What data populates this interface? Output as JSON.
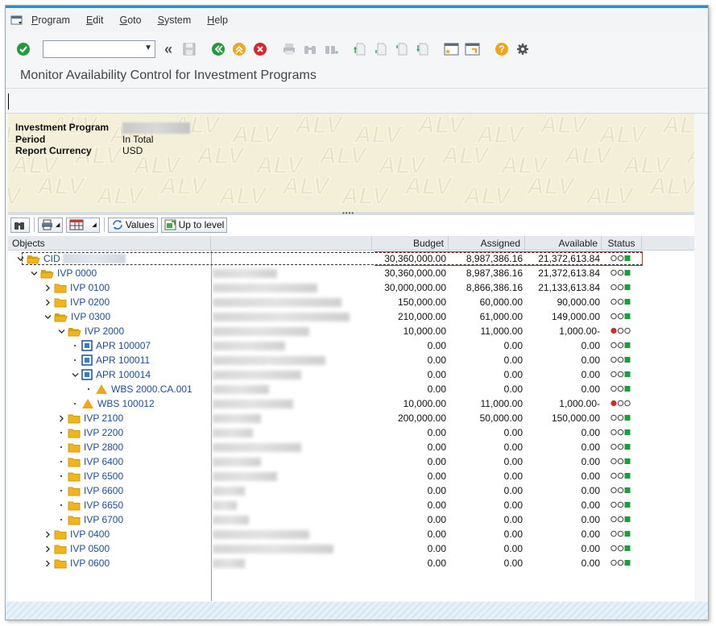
{
  "menu": {
    "items": [
      {
        "label": "Program",
        "underline": "P",
        "rest": "rogram"
      },
      {
        "label": "Edit",
        "underline": "E",
        "rest": "dit"
      },
      {
        "label": "Goto",
        "underline": "G",
        "rest": "oto"
      },
      {
        "label": "System",
        "underline": "S",
        "rest": "ystem"
      },
      {
        "label": "Help",
        "underline": "H",
        "rest": "elp"
      }
    ]
  },
  "title": "Monitor Availability Control for Investment Programs",
  "header": {
    "rows": [
      {
        "key": "Investment Program",
        "value": ""
      },
      {
        "key": "Period",
        "value": "In Total"
      },
      {
        "key": "Report Currency",
        "value": "USD"
      }
    ],
    "watermark": "ALV"
  },
  "grid_toolbar": {
    "values_label": "Values",
    "up_label": "Up to level"
  },
  "columns": {
    "objects": "Objects",
    "budget": "Budget",
    "assigned": "Assigned",
    "available": "Available",
    "status": "Status"
  },
  "rows": [
    {
      "label": "CID",
      "level": 0,
      "icon": "folder-open",
      "expander": "open",
      "budget": "30,360,000.00",
      "assigned": "8,987,386.16",
      "available": "21,372,613.84",
      "status": "green",
      "desc_w": 0
    },
    {
      "label": "IVP 0000",
      "level": 1,
      "icon": "folder-open",
      "expander": "open",
      "budget": "30,360,000.00",
      "assigned": "8,987,386.16",
      "available": "21,372,613.84",
      "status": "green",
      "desc_w": 80
    },
    {
      "label": "IVP 0100",
      "level": 2,
      "icon": "folder",
      "expander": "closed",
      "budget": "30,000,000.00",
      "assigned": "8,866,386.16",
      "available": "21,133,613.84",
      "status": "green",
      "desc_w": 130
    },
    {
      "label": "IVP 0200",
      "level": 2,
      "icon": "folder",
      "expander": "closed",
      "budget": "150,000.00",
      "assigned": "60,000.00",
      "available": "90,000.00",
      "status": "green",
      "desc_w": 160
    },
    {
      "label": "IVP 0300",
      "level": 2,
      "icon": "folder-open",
      "expander": "open",
      "budget": "210,000.00",
      "assigned": "61,000.00",
      "available": "149,000.00",
      "status": "green",
      "desc_w": 170
    },
    {
      "label": "IVP 2000",
      "level": 3,
      "icon": "folder-open",
      "expander": "open",
      "budget": "10,000.00",
      "assigned": "11,000.00",
      "available": "1,000.00-",
      "status": "red",
      "desc_w": 120
    },
    {
      "label": "APR 100007",
      "level": 4,
      "icon": "appr",
      "expander": "dot",
      "budget": "0.00",
      "assigned": "0.00",
      "available": "0.00",
      "status": "green",
      "desc_w": 90
    },
    {
      "label": "APR 100011",
      "level": 4,
      "icon": "appr",
      "expander": "dot",
      "budget": "0.00",
      "assigned": "0.00",
      "available": "0.00",
      "status": "green",
      "desc_w": 140
    },
    {
      "label": "APR 100014",
      "level": 4,
      "icon": "appr",
      "expander": "open",
      "budget": "0.00",
      "assigned": "0.00",
      "available": "0.00",
      "status": "green",
      "desc_w": 110
    },
    {
      "label": "WBS 2000.CA.001",
      "level": 5,
      "icon": "wbs",
      "expander": "dot",
      "budget": "0.00",
      "assigned": "0.00",
      "available": "0.00",
      "status": "green",
      "desc_w": 70
    },
    {
      "label": "WBS 100012",
      "level": 4,
      "icon": "wbs",
      "expander": "dot",
      "budget": "10,000.00",
      "assigned": "11,000.00",
      "available": "1,000.00-",
      "status": "red",
      "desc_w": 100
    },
    {
      "label": "IVP 2100",
      "level": 3,
      "icon": "folder",
      "expander": "closed",
      "budget": "200,000.00",
      "assigned": "50,000.00",
      "available": "150,000.00",
      "status": "green",
      "desc_w": 60
    },
    {
      "label": "IVP 2200",
      "level": 3,
      "icon": "folder",
      "expander": "dot",
      "budget": "0.00",
      "assigned": "0.00",
      "available": "0.00",
      "status": "green",
      "desc_w": 50
    },
    {
      "label": "IVP 2800",
      "level": 3,
      "icon": "folder",
      "expander": "dot",
      "budget": "0.00",
      "assigned": "0.00",
      "available": "0.00",
      "status": "green",
      "desc_w": 110
    },
    {
      "label": "IVP 6400",
      "level": 3,
      "icon": "folder",
      "expander": "dot",
      "budget": "0.00",
      "assigned": "0.00",
      "available": "0.00",
      "status": "green",
      "desc_w": 60
    },
    {
      "label": "IVP 6500",
      "level": 3,
      "icon": "folder",
      "expander": "dot",
      "budget": "0.00",
      "assigned": "0.00",
      "available": "0.00",
      "status": "green",
      "desc_w": 80
    },
    {
      "label": "IVP 6600",
      "level": 3,
      "icon": "folder",
      "expander": "dot",
      "budget": "0.00",
      "assigned": "0.00",
      "available": "0.00",
      "status": "green",
      "desc_w": 40
    },
    {
      "label": "IVP 6650",
      "level": 3,
      "icon": "folder",
      "expander": "dot",
      "budget": "0.00",
      "assigned": "0.00",
      "available": "0.00",
      "status": "green",
      "desc_w": 30
    },
    {
      "label": "IVP 6700",
      "level": 3,
      "icon": "folder",
      "expander": "dot",
      "budget": "0.00",
      "assigned": "0.00",
      "available": "0.00",
      "status": "green",
      "desc_w": 45
    },
    {
      "label": "IVP 0400",
      "level": 2,
      "icon": "folder",
      "expander": "closed",
      "budget": "0.00",
      "assigned": "0.00",
      "available": "0.00",
      "status": "green",
      "desc_w": 120
    },
    {
      "label": "IVP 0500",
      "level": 2,
      "icon": "folder",
      "expander": "closed",
      "budget": "0.00",
      "assigned": "0.00",
      "available": "0.00",
      "status": "green",
      "desc_w": 150
    },
    {
      "label": "IVP 0600",
      "level": 2,
      "icon": "folder",
      "expander": "closed",
      "budget": "0.00",
      "assigned": "0.00",
      "available": "0.00",
      "status": "green",
      "desc_w": 40
    }
  ],
  "colors": {
    "link_blue": "#1b4f9c",
    "folder_yellow": "#f2b41d",
    "status_red": "#d7262c",
    "status_green": "#1e9d3a",
    "accent_blue": "#2a8fd6"
  }
}
